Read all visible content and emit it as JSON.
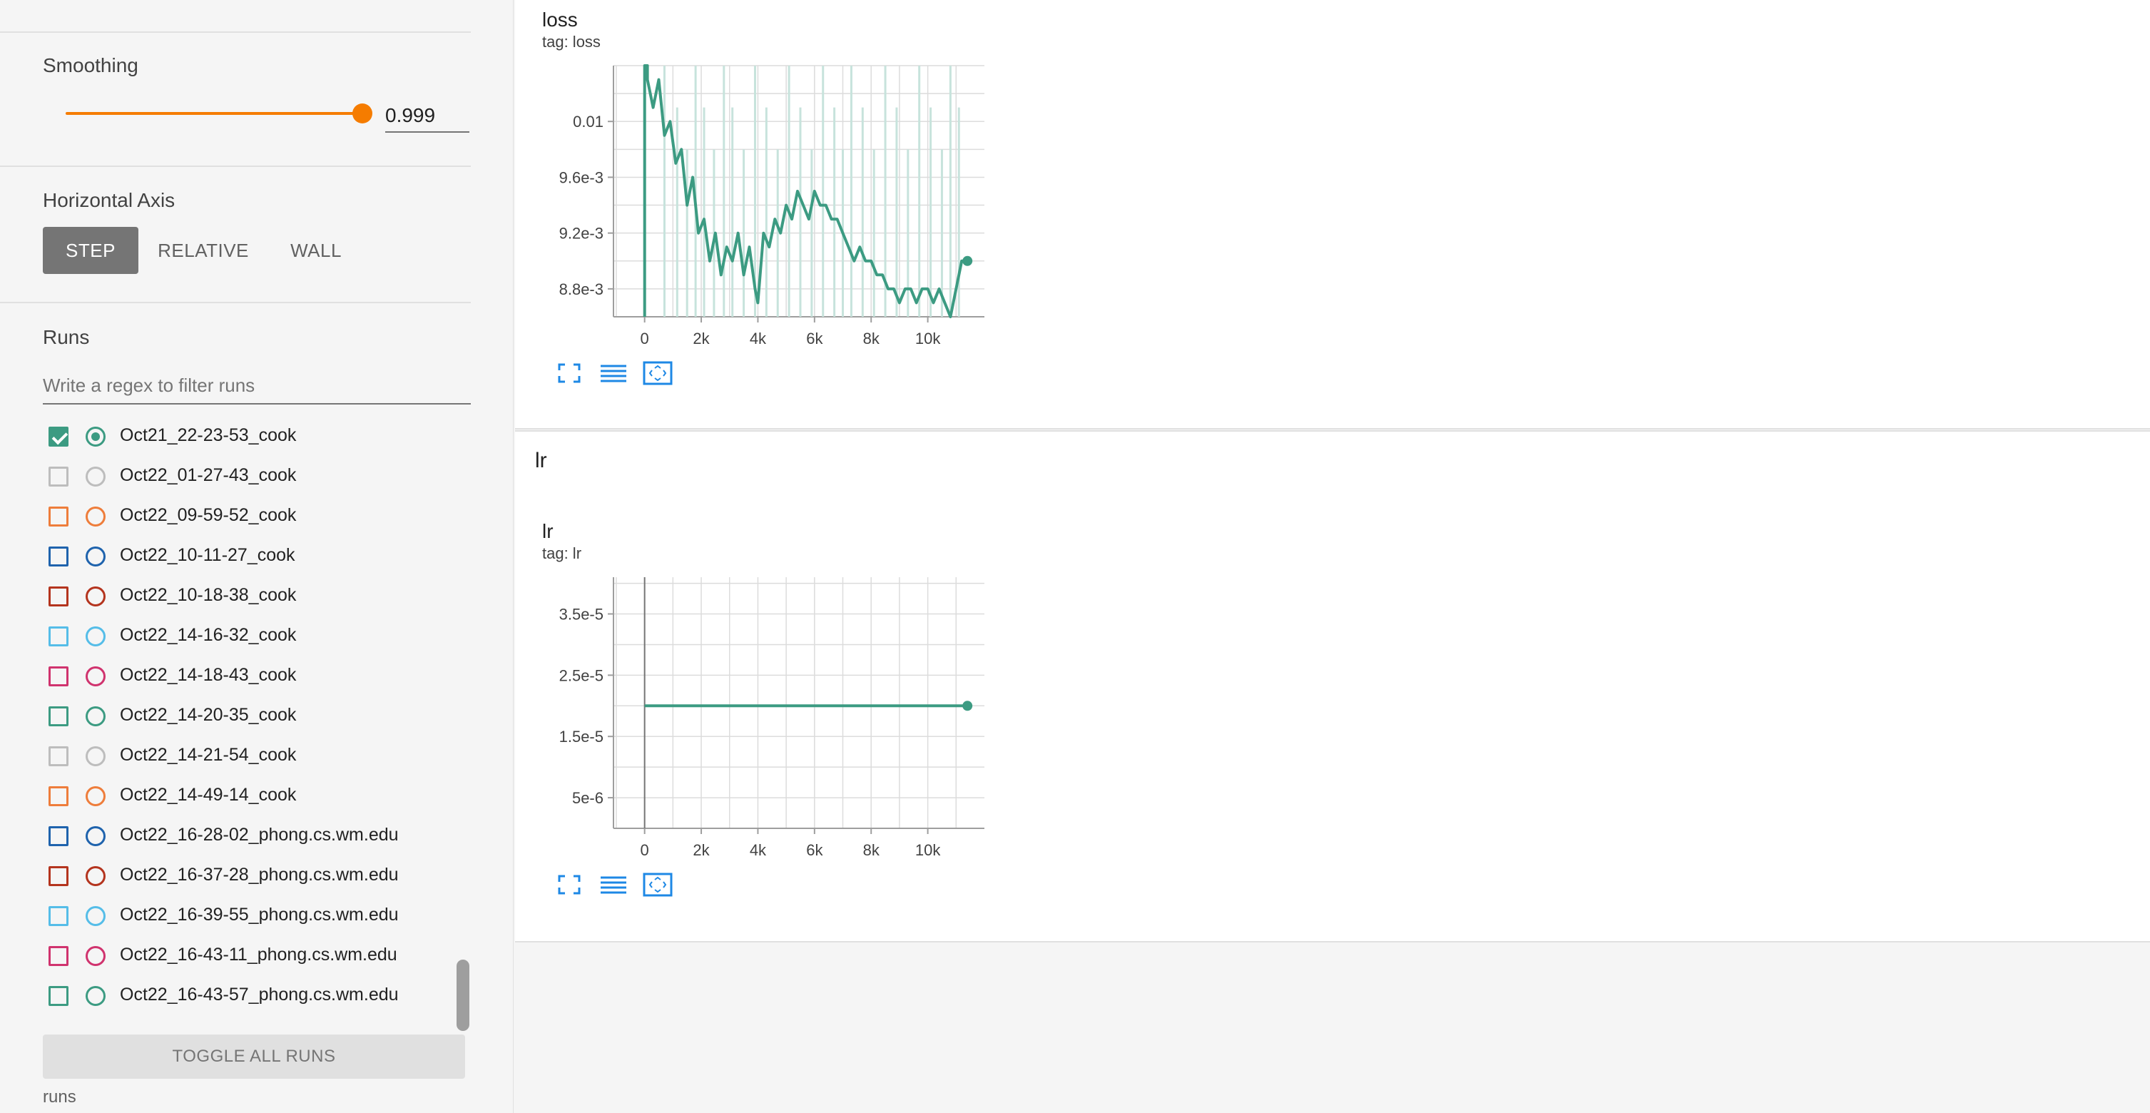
{
  "sidebar": {
    "smoothing": {
      "title": "Smoothing",
      "value": "0.999",
      "fraction": 0.999
    },
    "horizontal_axis": {
      "title": "Horizontal Axis",
      "options": [
        "STEP",
        "RELATIVE",
        "WALL"
      ],
      "selected": "STEP"
    },
    "runs": {
      "title": "Runs",
      "filter_placeholder": "Write a regex to filter runs",
      "items": [
        {
          "name": "Oct21_22-23-53_cook",
          "checked": true,
          "selected": true,
          "color": "#3c9b82"
        },
        {
          "name": "Oct22_01-27-43_cook",
          "checked": false,
          "selected": false,
          "color": "#bdbdbd"
        },
        {
          "name": "Oct22_09-59-52_cook",
          "checked": false,
          "selected": false,
          "color": "#ee7d3b"
        },
        {
          "name": "Oct22_10-11-27_cook",
          "checked": false,
          "selected": false,
          "color": "#1f63ad"
        },
        {
          "name": "Oct22_10-18-38_cook",
          "checked": false,
          "selected": false,
          "color": "#b4341e"
        },
        {
          "name": "Oct22_14-16-32_cook",
          "checked": false,
          "selected": false,
          "color": "#55bde8"
        },
        {
          "name": "Oct22_14-18-43_cook",
          "checked": false,
          "selected": false,
          "color": "#d0336e"
        },
        {
          "name": "Oct22_14-20-35_cook",
          "checked": false,
          "selected": false,
          "color": "#3c9b82"
        },
        {
          "name": "Oct22_14-21-54_cook",
          "checked": false,
          "selected": false,
          "color": "#bdbdbd"
        },
        {
          "name": "Oct22_14-49-14_cook",
          "checked": false,
          "selected": false,
          "color": "#ee7d3b"
        },
        {
          "name": "Oct22_16-28-02_phong.cs.wm.edu",
          "checked": false,
          "selected": false,
          "color": "#1f63ad"
        },
        {
          "name": "Oct22_16-37-28_phong.cs.wm.edu",
          "checked": false,
          "selected": false,
          "color": "#b4341e"
        },
        {
          "name": "Oct22_16-39-55_phong.cs.wm.edu",
          "checked": false,
          "selected": false,
          "color": "#55bde8"
        },
        {
          "name": "Oct22_16-43-11_phong.cs.wm.edu",
          "checked": false,
          "selected": false,
          "color": "#d0336e"
        },
        {
          "name": "Oct22_16-43-57_phong.cs.wm.edu",
          "checked": false,
          "selected": false,
          "color": "#3c9b82"
        }
      ],
      "toggle_all_label": "TOGGLE ALL RUNS",
      "footer": "runs"
    }
  },
  "main": {
    "group_lr_title": "lr",
    "charts": [
      {
        "title": "loss",
        "tag": "tag: loss"
      },
      {
        "title": "lr",
        "tag": "tag: lr"
      }
    ]
  },
  "icons": {
    "fullscreen": "fullscreen-icon",
    "toggle_log": "lines-icon",
    "fit_domain": "fit-domain-icon"
  },
  "colors": {
    "accent": "#f57c00",
    "series": "#3c9b82",
    "raw_series": "#c7e3dc",
    "tool_icon": "#1e88e5"
  },
  "chart_data": [
    {
      "type": "line",
      "title": "loss",
      "xlabel": "",
      "ylabel": "",
      "xlim": [
        -1100,
        12000
      ],
      "ylim": [
        0.0086,
        0.0104
      ],
      "x_ticks": [
        0,
        2000,
        4000,
        6000,
        8000,
        10000
      ],
      "x_tick_labels": [
        "0",
        "2k",
        "4k",
        "6k",
        "8k",
        "10k"
      ],
      "y_ticks": [
        0.0088,
        0.0092,
        0.0096,
        0.01
      ],
      "y_tick_labels": [
        "8.8e-3",
        "9.2e-3",
        "9.6e-3",
        "0.01"
      ],
      "grid": true,
      "series": [
        {
          "smoothed": true,
          "x": [
            0,
            0,
            100,
            100,
            300,
            500,
            700,
            900,
            1100,
            1300,
            1500,
            1700,
            1900,
            2100,
            2300,
            2500,
            2700,
            2900,
            3100,
            3300,
            3500,
            3700,
            3900,
            4000,
            4200,
            4400,
            4600,
            4800,
            5000,
            5200,
            5400,
            5600,
            5800,
            6000,
            6200,
            6400,
            6600,
            6800,
            7000,
            7200,
            7400,
            7600,
            7800,
            8000,
            8200,
            8400,
            8600,
            8800,
            9000,
            9200,
            9400,
            9600,
            9800,
            10000,
            10200,
            10400,
            10600,
            10800,
            11000,
            11200,
            11400
          ],
          "y": [
            0.0086,
            0.0104,
            0.0104,
            0.0103,
            0.0101,
            0.0103,
            0.0099,
            0.01,
            0.0097,
            0.0098,
            0.0094,
            0.0096,
            0.0092,
            0.0093,
            0.009,
            0.0092,
            0.0089,
            0.0091,
            0.009,
            0.0092,
            0.0089,
            0.0091,
            0.0088,
            0.0087,
            0.0092,
            0.0091,
            0.0093,
            0.0092,
            0.0094,
            0.0093,
            0.0095,
            0.0094,
            0.0093,
            0.0095,
            0.0094,
            0.0094,
            0.0093,
            0.0093,
            0.0092,
            0.0091,
            0.009,
            0.0091,
            0.009,
            0.009,
            0.0089,
            0.0089,
            0.0088,
            0.0088,
            0.0087,
            0.0088,
            0.0088,
            0.0087,
            0.0088,
            0.0088,
            0.0087,
            0.0088,
            0.0087,
            0.0086,
            0.0088,
            0.009,
            0.009
          ]
        }
      ]
    },
    {
      "type": "line",
      "title": "lr",
      "xlabel": "",
      "ylabel": "",
      "xlim": [
        -1100,
        12000
      ],
      "ylim": [
        0,
        0.00041
      ],
      "x_ticks": [
        0,
        2000,
        4000,
        6000,
        8000,
        10000
      ],
      "x_tick_labels": [
        "0",
        "2k",
        "4k",
        "6k",
        "8k",
        "10k"
      ],
      "y_ticks": [
        5e-05,
        0.00015,
        0.00025,
        0.00035
      ],
      "y_tick_labels": [
        "5e-6",
        "1.5e-5",
        "2.5e-5",
        "3.5e-5"
      ],
      "grid": true,
      "series": [
        {
          "smoothed": true,
          "x": [
            0,
            11400
          ],
          "y": [
            0.0002,
            0.0002
          ]
        }
      ]
    }
  ]
}
